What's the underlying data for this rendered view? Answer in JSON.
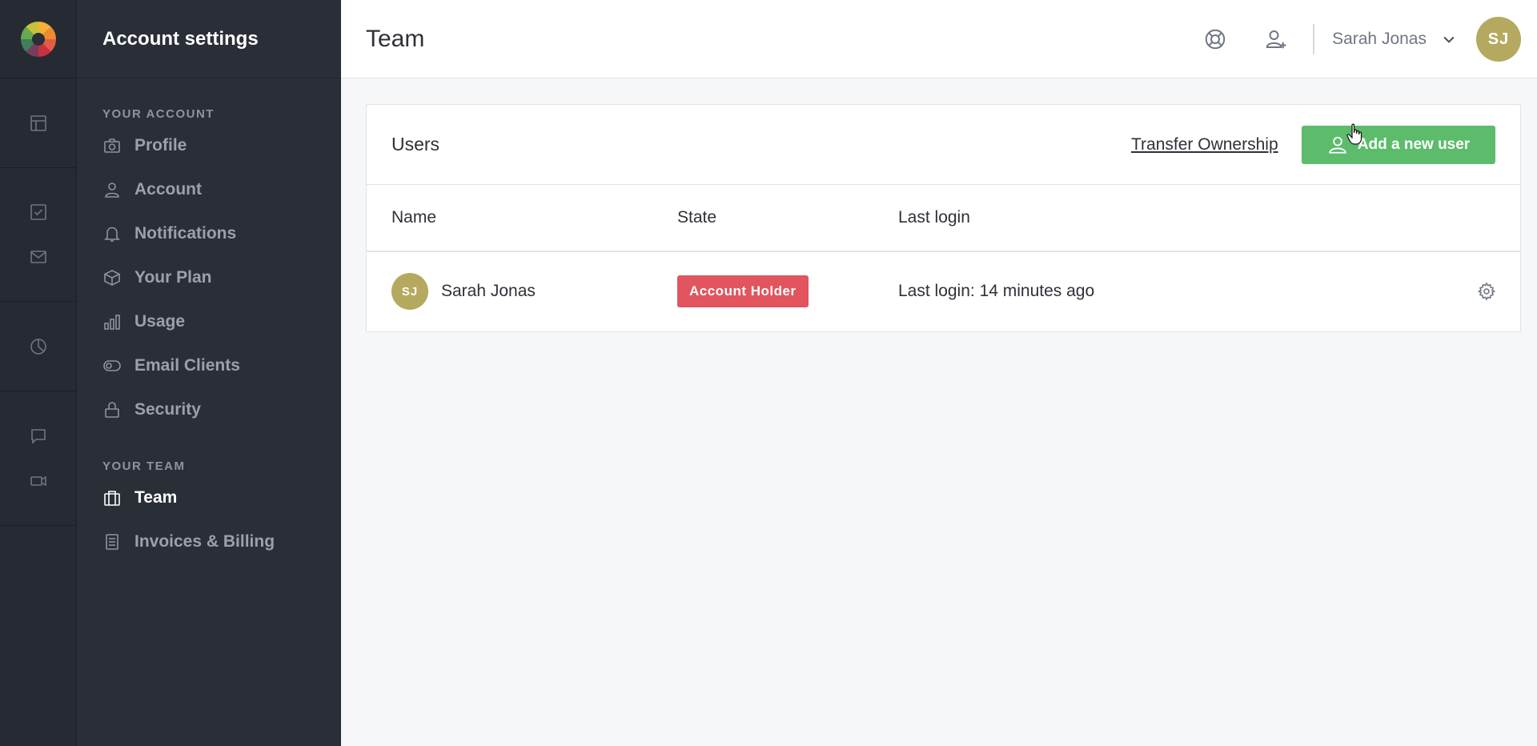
{
  "sidebar": {
    "title": "Account settings",
    "sections": [
      {
        "label": "YOUR ACCOUNT",
        "items": [
          {
            "label": "Profile",
            "icon": "camera-icon"
          },
          {
            "label": "Account",
            "icon": "user-icon"
          },
          {
            "label": "Notifications",
            "icon": "bell-icon"
          },
          {
            "label": "Your Plan",
            "icon": "box-icon"
          },
          {
            "label": "Usage",
            "icon": "bar-chart-icon"
          },
          {
            "label": "Email Clients",
            "icon": "toggle-icon"
          },
          {
            "label": "Security",
            "icon": "lock-icon"
          }
        ]
      },
      {
        "label": "YOUR TEAM",
        "items": [
          {
            "label": "Team",
            "icon": "briefcase-icon",
            "active": true
          },
          {
            "label": "Invoices & Billing",
            "icon": "document-icon"
          }
        ]
      }
    ]
  },
  "rail": {
    "icons": [
      "layout-icon",
      "checkbox-icon",
      "mail-icon",
      "pie-chart-icon",
      "chat-icon",
      "video-icon"
    ]
  },
  "header": {
    "page_title": "Team",
    "icons": [
      "help-lifebuoy-icon",
      "add-user-icon"
    ],
    "user_name": "Sarah Jonas",
    "user_initials": "SJ",
    "avatar_color": "#b5a95f"
  },
  "users_card": {
    "title": "Users",
    "transfer_label": "Transfer Ownership",
    "add_user_label": "Add a new user",
    "add_user_color": "#5cbc6b",
    "columns": [
      "Name",
      "State",
      "Last login"
    ],
    "rows": [
      {
        "initials": "SJ",
        "name": "Sarah Jonas",
        "state": "Account Holder",
        "state_color": "#e2545e",
        "last_login": "Last login: 14 minutes ago"
      }
    ]
  }
}
